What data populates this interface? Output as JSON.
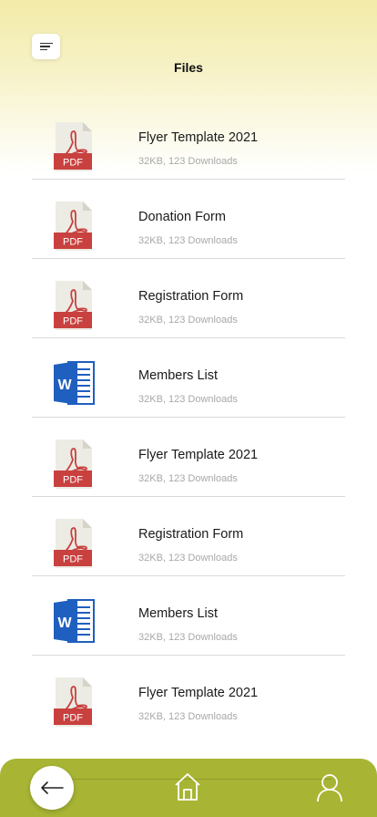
{
  "header": {
    "title": "Files",
    "menu_icon": "menu-icon"
  },
  "files": [
    {
      "name": "Flyer Template 2021",
      "meta": "32KB, 123 Downloads",
      "type": "pdf",
      "icon": "pdf-icon"
    },
    {
      "name": "Donation Form",
      "meta": "32KB, 123 Downloads",
      "type": "pdf",
      "icon": "pdf-icon"
    },
    {
      "name": "Registration Form",
      "meta": "32KB, 123 Downloads",
      "type": "pdf",
      "icon": "pdf-icon"
    },
    {
      "name": "Members List",
      "meta": "32KB, 123 Downloads",
      "type": "word",
      "icon": "word-icon"
    },
    {
      "name": "Flyer Template 2021",
      "meta": "32KB, 123 Downloads",
      "type": "pdf",
      "icon": "pdf-icon"
    },
    {
      "name": "Registration Form",
      "meta": "32KB, 123 Downloads",
      "type": "pdf",
      "icon": "pdf-icon"
    },
    {
      "name": "Members List",
      "meta": "32KB, 123 Downloads",
      "type": "word",
      "icon": "word-icon"
    },
    {
      "name": "Flyer Template 2021",
      "meta": "32KB, 123 Downloads",
      "type": "pdf",
      "icon": "pdf-icon"
    }
  ],
  "pdf_icon_label": "PDF",
  "word_icon_label": "W",
  "bottom_nav": {
    "back_icon": "arrow-left-icon",
    "home_icon": "home-icon",
    "profile_icon": "user-icon"
  },
  "colors": {
    "header_gradient_top": "#f2eba8",
    "nav_bar": "#a8b534",
    "pdf_red": "#c8413f",
    "word_blue": "#1f5fbf",
    "meta_text": "#a8a8a8"
  }
}
